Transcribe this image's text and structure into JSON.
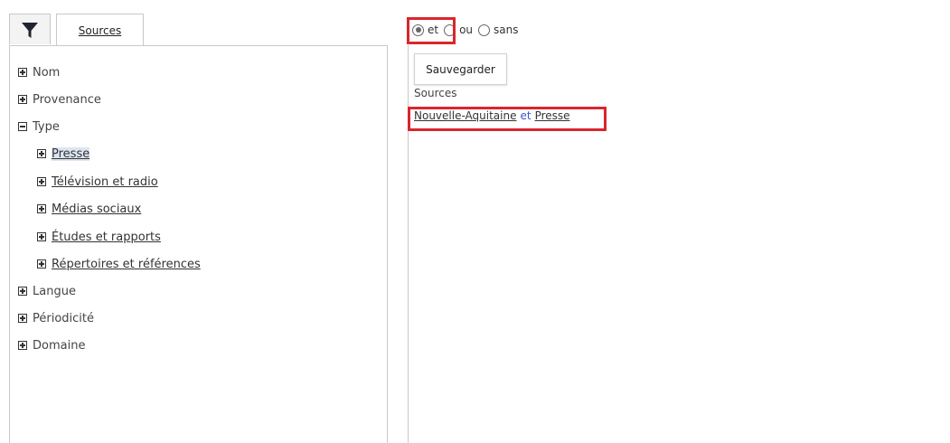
{
  "tabs": {
    "filter_icon": "filter-icon",
    "sources_label": "Sources"
  },
  "tree": {
    "nom": "Nom",
    "provenance": "Provenance",
    "type": "Type",
    "type_children": {
      "presse": "Presse",
      "television": "Télévision et radio",
      "medias": "Médias sociaux",
      "etudes": "Études et rapports",
      "repertoires": "Répertoires et références"
    },
    "langue": "Langue",
    "periodicite": "Périodicité",
    "domaine": "Domaine"
  },
  "operator": {
    "options": [
      "et",
      "ou",
      "sans"
    ],
    "selected": "et"
  },
  "save_label": "Sauvegarder",
  "section_label": "Sources",
  "expression": {
    "term1": "Nouvelle-Aquitaine",
    "op": "et",
    "term2": "Presse"
  },
  "colors": {
    "highlight": "#d9262c",
    "operator_text": "#3a57c9",
    "selected_bg": "#dce6f2"
  }
}
